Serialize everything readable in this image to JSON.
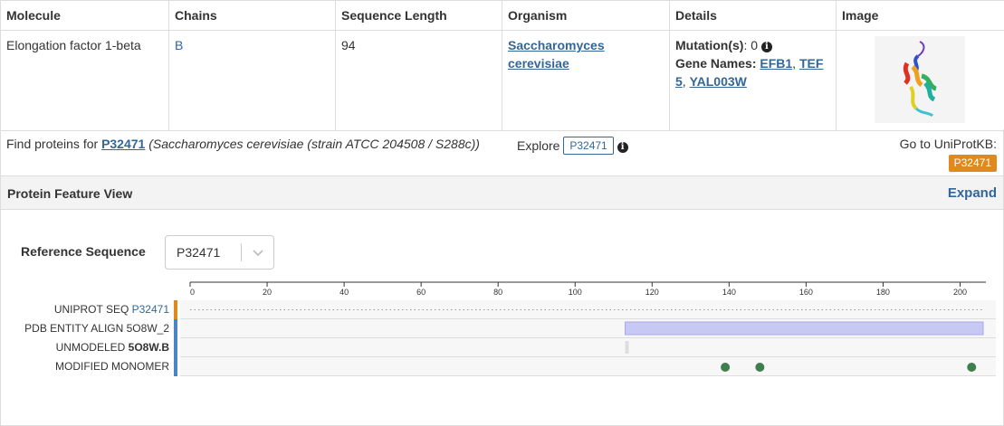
{
  "table": {
    "headers": [
      "Molecule",
      "Chains",
      "Sequence Length",
      "Organism",
      "Details",
      "Image"
    ],
    "row": {
      "molecule": "Elongation factor 1-beta",
      "chain": "B",
      "length": "94",
      "organism_line1": "Saccharomyces",
      "organism_line2": "cerevisiae",
      "mutation_label": "Mutation(s)",
      "mutation_value": ": 0",
      "gene_label": "Gene Names:",
      "gene1": "EFB1",
      "gene2a": "TEF",
      "gene2b": "5",
      "gene3": "YAL003W"
    }
  },
  "find": {
    "prefix": "Find proteins for",
    "accession": "P32471",
    "organism_note": "(Saccharomyces cerevisiae (strain ATCC 204508 / S288c))",
    "explore_label": "Explore",
    "explore_badge": "P32471",
    "goto_label": "Go to UniProtKB:",
    "goto_badge": "P32471"
  },
  "panel": {
    "title": "Protein Feature View",
    "expand": "Expand",
    "ref_label": "Reference Sequence",
    "ref_value": "P32471"
  },
  "viewer": {
    "axis_min": 0,
    "axis_max": 206,
    "ticks": [
      0,
      20,
      40,
      60,
      80,
      100,
      120,
      140,
      160,
      180,
      200
    ],
    "rows": [
      {
        "label": "UNIPROT SEQ ",
        "label_link": "P32471",
        "color": "#e0891e"
      },
      {
        "label": "PDB ENTITY ALIGN 5O8W_2",
        "color": "#4a86c5"
      },
      {
        "label": "UNMODELED ",
        "label_bold": "5O8W.B",
        "color": "#4a86c5"
      },
      {
        "label": "MODIFIED MONOMER",
        "color": "#4a86c5"
      }
    ],
    "align_range": [
      113,
      206
    ],
    "unmodeled_residue": 113,
    "modified_residues": [
      139,
      148,
      203
    ],
    "align_color": "#c8c8f5",
    "marker_color": "#3f7f4f"
  }
}
